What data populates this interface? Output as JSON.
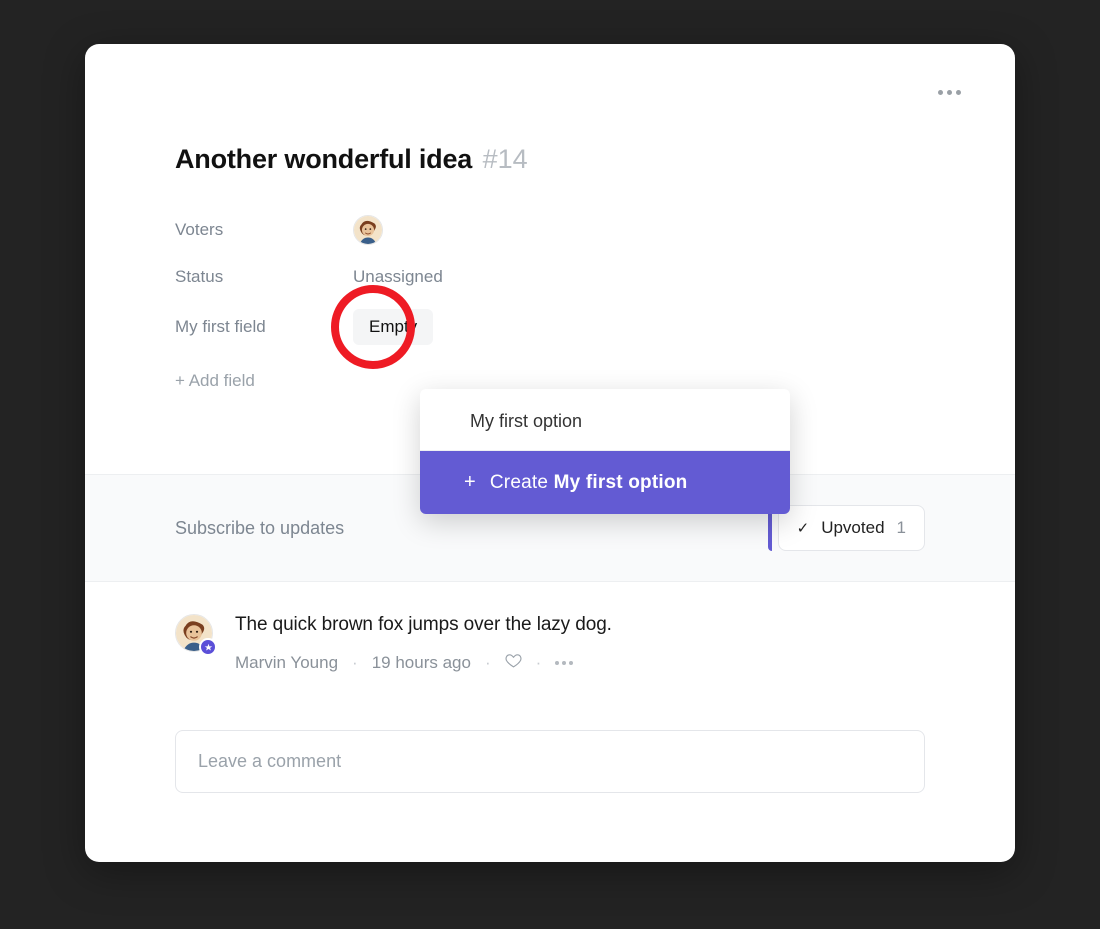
{
  "title": {
    "text": "Another wonderful idea",
    "number": "#14"
  },
  "fields": {
    "voters_label": "Voters",
    "status_label": "Status",
    "status_value": "Unassigned",
    "custom_label": "My first field",
    "custom_value": "Empty",
    "add_field": "+ Add field"
  },
  "dropdown": {
    "search_value": "My first option",
    "create_prefix": "Create",
    "create_name": "My first option"
  },
  "subscribe": {
    "label": "Subscribe to updates"
  },
  "upvote": {
    "label": "Upvoted",
    "count": "1"
  },
  "comment": {
    "text": "The quick brown fox jumps over the lazy dog.",
    "author": "Marvin Young",
    "time": "19 hours ago"
  },
  "comment_input": {
    "placeholder": "Leave a comment"
  }
}
